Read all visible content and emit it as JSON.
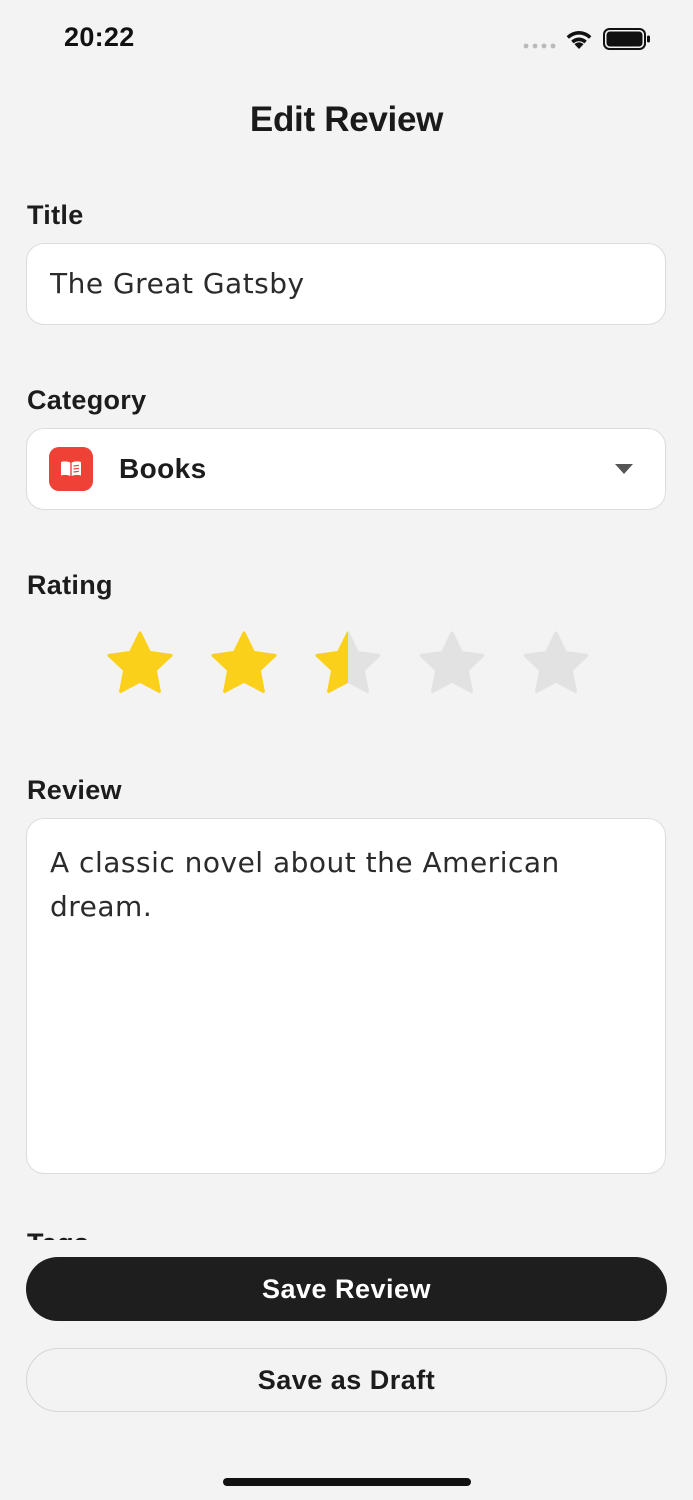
{
  "status_bar": {
    "time": "20:22",
    "icons": [
      "signal-icon",
      "wifi-icon",
      "battery-icon"
    ]
  },
  "header": {
    "title": "Edit Review"
  },
  "form": {
    "title_field": {
      "label": "Title",
      "value": "The Great Gatsby"
    },
    "category_field": {
      "label": "Category",
      "value": "Books",
      "icon": "book-icon",
      "icon_color": "#ef4136"
    },
    "rating_field": {
      "label": "Rating",
      "value": 2.5,
      "max": 5,
      "filled_color": "#fbd01a",
      "empty_color": "#e2e2e2"
    },
    "review_field": {
      "label": "Review",
      "value": "A classic novel about the American dream."
    },
    "tags_field": {
      "label": "Tags"
    }
  },
  "actions": {
    "save_label": "Save Review",
    "draft_label": "Save as Draft"
  }
}
